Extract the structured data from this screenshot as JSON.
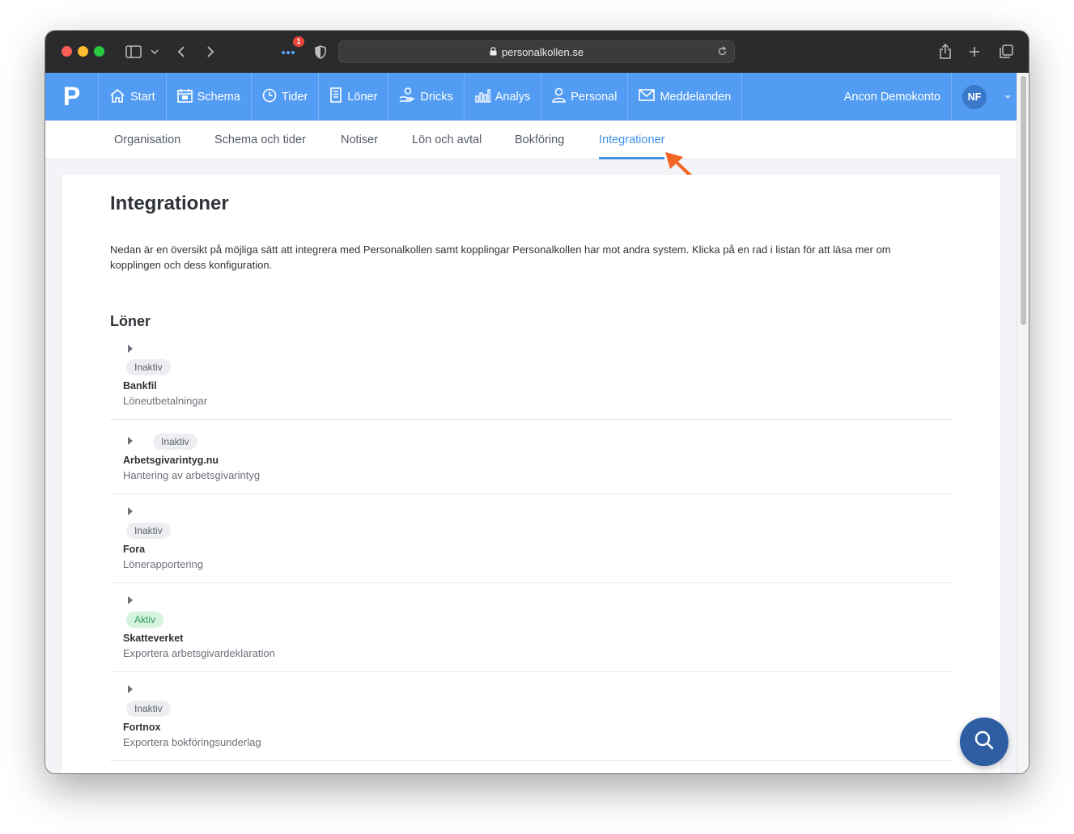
{
  "browser": {
    "url": "personalkollen.se",
    "notification_count": "1"
  },
  "nav": {
    "logo": "P",
    "items": [
      {
        "label": "Start",
        "icon": "home-icon"
      },
      {
        "label": "Schema",
        "icon": "calendar-icon"
      },
      {
        "label": "Tider",
        "icon": "clock-icon"
      },
      {
        "label": "Löner",
        "icon": "document-icon"
      },
      {
        "label": "Dricks",
        "icon": "hand-coin-icon"
      },
      {
        "label": "Analys",
        "icon": "bar-chart-icon"
      },
      {
        "label": "Personal",
        "icon": "person-icon"
      },
      {
        "label": "Meddelanden",
        "icon": "envelope-icon"
      }
    ],
    "account_name": "Ancon Demokonto",
    "avatar_initials": "NF"
  },
  "subnav": {
    "tabs": [
      "Organisation",
      "Schema och tider",
      "Notiser",
      "Lön och avtal",
      "Bokföring",
      "Integrationer"
    ],
    "active": "Integrationer"
  },
  "page": {
    "title": "Integrationer",
    "intro": "Nedan är en översikt på möjliga sätt att integrera med Personalkollen samt kopplingar Personalkollen har mot andra system. Klicka på en rad i listan för att läsa mer om kopplingen och dess konfiguration.",
    "section_title": "Löner",
    "integrations": [
      {
        "status": "Inaktiv",
        "name": "Bankfil",
        "description": "Löneutbetalningar"
      },
      {
        "status": "Inaktiv",
        "name": "Arbetsgivarintyg.nu",
        "description": "Hantering av arbetsgivarintyg"
      },
      {
        "status": "Inaktiv",
        "name": "Fora",
        "description": "Lönerapportering"
      },
      {
        "status": "Aktiv",
        "name": "Skatteverket",
        "description": "Exportera arbetsgivardeklaration"
      },
      {
        "status": "Inaktiv",
        "name": "Fortnox",
        "description": "Exportera bokföringsunderlag"
      }
    ]
  },
  "colors": {
    "nav_blue": "#539cf3",
    "active_tab": "#3f8fe8",
    "annotation_arrow": "#f26522",
    "status_active": "#2f9b55",
    "fab": "#2e5da3"
  }
}
